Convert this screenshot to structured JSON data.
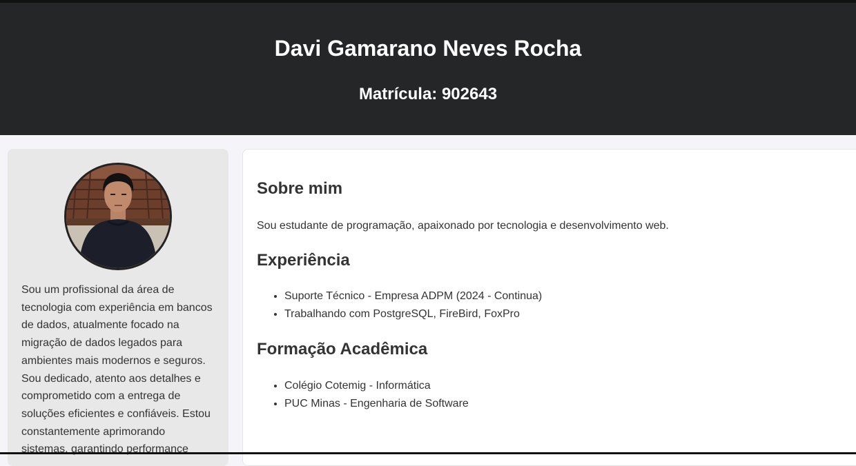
{
  "header": {
    "name": "Davi Gamarano Neves Rocha",
    "registration": "Matrícula: 902643"
  },
  "sidebar": {
    "avatar_icon": "profile-photo",
    "bio": "Sou um profissional da área de tecnologia com experiência em bancos de dados, atualmente focado na migração de dados legados para ambientes mais modernos e seguros. Sou dedicado, atento aos detalhes e comprometido com a entrega de soluções eficientes e confiáveis. Estou constantemente aprimorando sistemas, garantindo performance"
  },
  "main": {
    "about": {
      "title": "Sobre mim",
      "text": "Sou estudante de programação, apaixonado por tecnologia e desenvolvimento web."
    },
    "experience": {
      "title": "Experiência",
      "items": [
        "Suporte Técnico - Empresa ADPM (2024 - Continua)",
        "Trabalhando com PostgreSQL, FireBird, FoxPro"
      ]
    },
    "education": {
      "title": "Formação Acadêmica",
      "items": [
        "Colégio Cotemig - Informática",
        "PUC Minas - Engenharia de Software"
      ]
    }
  },
  "colors": {
    "header_bg": "#252627",
    "page_bg": "#f4f4f9",
    "sidebar_bg": "#e8e8e8",
    "card_bg": "#ffffff",
    "text": "#333333"
  }
}
